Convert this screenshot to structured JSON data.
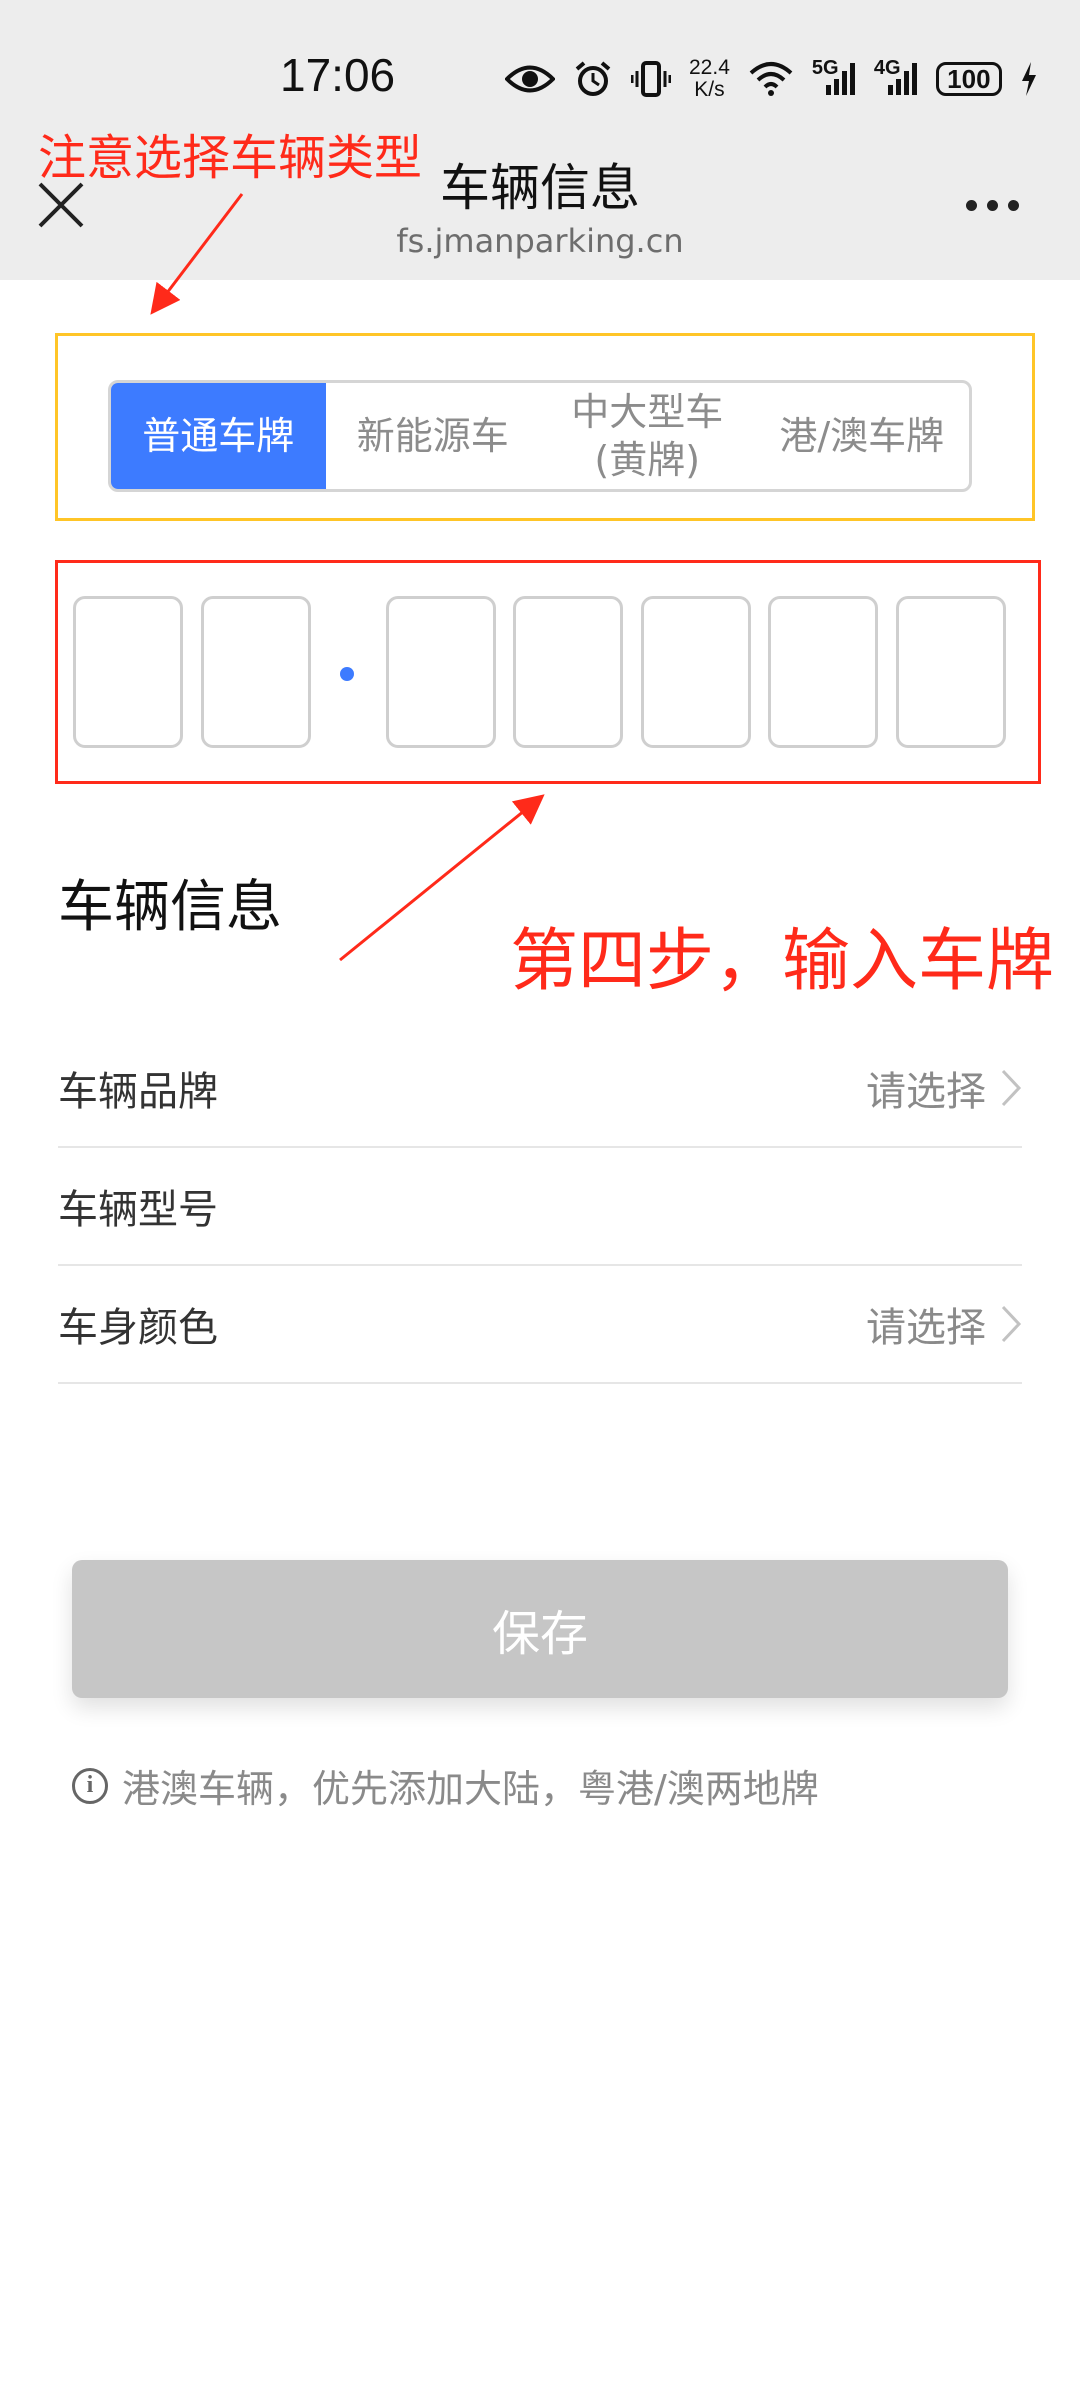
{
  "status_bar": {
    "time": "17:06",
    "speed_value": "22.4",
    "speed_unit": "K/s",
    "network_5g": "5G",
    "network_4g": "4G",
    "battery": "100"
  },
  "nav": {
    "title": "车辆信息",
    "url": "fs.jmanparking.cn"
  },
  "annotations": {
    "top_note": "注意选择车辆类型",
    "step_note": "第四步，输入车牌"
  },
  "plate_types": [
    {
      "label": "普通车牌",
      "active": true
    },
    {
      "label": "新能源车",
      "active": false
    },
    {
      "line1": "中大型车",
      "line2": "(黄牌)",
      "active": false
    },
    {
      "label": "港/澳车牌",
      "active": false
    }
  ],
  "plate_input": {
    "cells": [
      "",
      "",
      "",
      "",
      "",
      "",
      ""
    ]
  },
  "section": {
    "title": "车辆信息"
  },
  "form": {
    "brand_label": "车辆品牌",
    "brand_value": "请选择",
    "model_label": "车辆型号",
    "color_label": "车身颜色",
    "color_value": "请选择"
  },
  "actions": {
    "save_label": "保存"
  },
  "tip": {
    "icon_glyph": "i",
    "text": "港澳车辆，优先添加大陆，粤港/澳两地牌"
  },
  "colors": {
    "accent": "#3d7bff",
    "annotation": "#ff2a1a",
    "highlight_box": "#ffc527",
    "disabled_button": "#c6c6c6"
  }
}
